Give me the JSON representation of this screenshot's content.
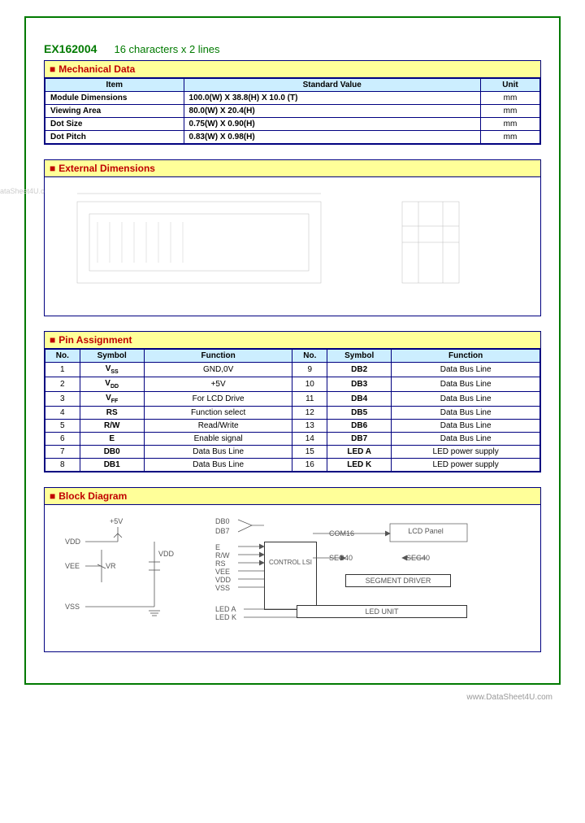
{
  "header": {
    "part_number": "EX162004",
    "subtitle": "16 characters x 2 lines"
  },
  "mechanical": {
    "title": "Mechanical Data",
    "headers": {
      "item": "Item",
      "std": "Standard Value",
      "unit": "Unit"
    },
    "rows": [
      {
        "item": "Module Dimensions",
        "std": "100.0(W) X 38.8(H) X 10.0 (T)",
        "unit": "mm"
      },
      {
        "item": "Viewing Area",
        "std": "80.0(W) X 20.4(H)",
        "unit": "mm"
      },
      {
        "item": "Dot Size",
        "std": "0.75(W) X 0.90(H)",
        "unit": "mm"
      },
      {
        "item": "Dot Pitch",
        "std": "0.83(W) X 0.98(H)",
        "unit": "mm"
      }
    ]
  },
  "external_dimensions": {
    "title": "External Dimensions"
  },
  "pins": {
    "title": "Pin Assignment",
    "headers": {
      "no": "No.",
      "sym": "Symbol",
      "fn": "Function"
    },
    "left": [
      {
        "no": "1",
        "sym": "V",
        "sub": "SS",
        "fn": "GND,0V"
      },
      {
        "no": "2",
        "sym": "V",
        "sub": "DD",
        "fn": "+5V"
      },
      {
        "no": "3",
        "sym": "V",
        "sub": "FF",
        "fn": "For LCD Drive"
      },
      {
        "no": "4",
        "sym": "RS",
        "sub": "",
        "fn": "Function select"
      },
      {
        "no": "5",
        "sym": "R/W",
        "sub": "",
        "fn": "Read/Write"
      },
      {
        "no": "6",
        "sym": "E",
        "sub": "",
        "fn": "Enable signal"
      },
      {
        "no": "7",
        "sym": "DB0",
        "sub": "",
        "fn": "Data Bus Line"
      },
      {
        "no": "8",
        "sym": "DB1",
        "sub": "",
        "fn": "Data Bus Line"
      }
    ],
    "right": [
      {
        "no": "9",
        "sym": "DB2",
        "fn": "Data Bus Line"
      },
      {
        "no": "10",
        "sym": "DB3",
        "fn": "Data Bus Line"
      },
      {
        "no": "11",
        "sym": "DB4",
        "fn": "Data Bus Line"
      },
      {
        "no": "12",
        "sym": "DB5",
        "fn": "Data Bus Line"
      },
      {
        "no": "13",
        "sym": "DB6",
        "fn": "Data Bus Line"
      },
      {
        "no": "14",
        "sym": "DB7",
        "fn": "Data Bus Line"
      },
      {
        "no": "15",
        "sym": "LED A",
        "fn": "LED power supply"
      },
      {
        "no": "16",
        "sym": "LED K",
        "fn": "LED power supply"
      }
    ]
  },
  "block": {
    "title": "Block Diagram",
    "left_labels": {
      "vdd": "VDD",
      "vee": "VEE",
      "vss": "VSS",
      "v5": "+5V",
      "vr": "VR",
      "vdd2": "VDD"
    },
    "right_labels": {
      "db0": "DB0",
      "db7": "DB7",
      "e": "E",
      "rw": "R/W",
      "rs": "RS",
      "vee": "VEE",
      "vdd": "VDD",
      "vss": "VSS",
      "leda": "LED A",
      "ledk": "LED K",
      "control": "CONTROL LSI",
      "com16": "COM16",
      "seg40a": "SEG40",
      "seg40b": "SEG40",
      "lcdpanel": "LCD Panel",
      "segdriver": "SEGMENT DRIVER",
      "ledunit": "LED UNIT"
    }
  },
  "watermark": "www.DataSheet4U.com",
  "footer": "www.DataSheet4U.com"
}
